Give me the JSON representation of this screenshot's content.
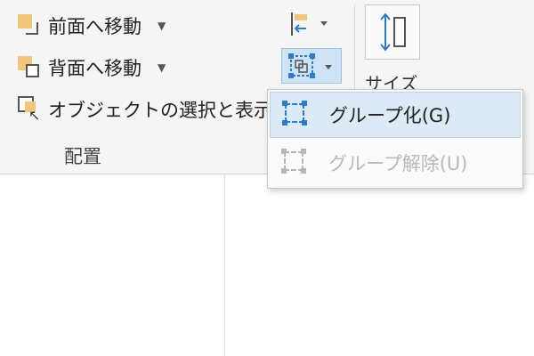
{
  "ribbon": {
    "bring_forward": {
      "label": "前面へ移動",
      "icon": "bring-forward-icon"
    },
    "send_backward": {
      "label": "背面へ移動",
      "icon": "send-backward-icon"
    },
    "selection_pane": {
      "label": "オブジェクトの選択と表示",
      "icon": "selection-pane-icon"
    },
    "group_label": "配置",
    "align": {
      "icon": "align-icon"
    },
    "group": {
      "icon": "group-icon"
    },
    "size": {
      "label": "サイズ",
      "icon": "size-icon"
    }
  },
  "dropdown": {
    "items": [
      {
        "label": "グループ化(G)",
        "state": "active",
        "icon": "group-objects-icon"
      },
      {
        "label": "グループ解除(U)",
        "state": "disabled",
        "icon": "ungroup-objects-icon"
      }
    ]
  },
  "colors": {
    "accent": "#2a7bd1",
    "highlight": "#dce9f7",
    "object_fill": "#f4c67a",
    "disabled_text": "#b9b9b9"
  }
}
